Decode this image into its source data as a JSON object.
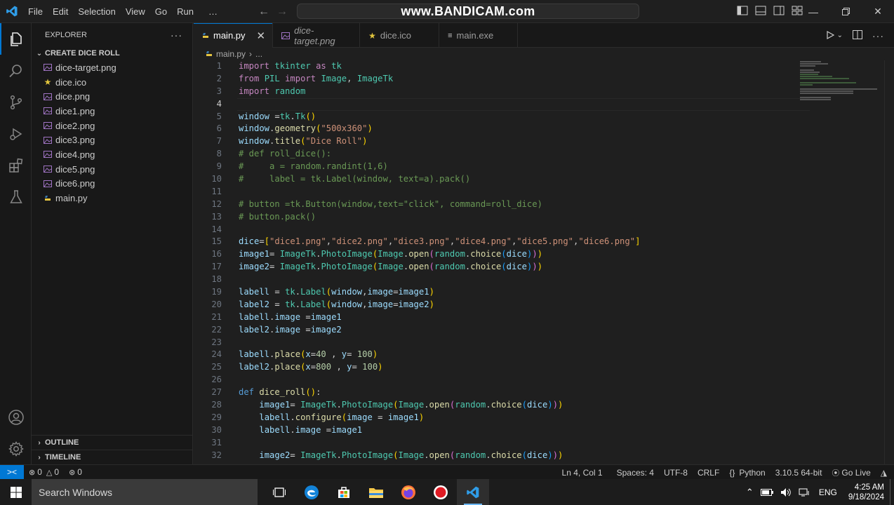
{
  "menu": [
    "File",
    "Edit",
    "Selection",
    "View",
    "Go",
    "Run",
    "…"
  ],
  "watermark": "www.BANDICAM.com",
  "sidebar": {
    "title": "EXPLORER",
    "more": "···",
    "folder": "CREATE DICE ROLL",
    "files": [
      {
        "name": "dice-target.png",
        "icon": "image-file-icon"
      },
      {
        "name": "dice.ico",
        "icon": "star-file-icon"
      },
      {
        "name": "dice.png",
        "icon": "image-file-icon"
      },
      {
        "name": "dice1.png",
        "icon": "image-file-icon"
      },
      {
        "name": "dice2.png",
        "icon": "image-file-icon"
      },
      {
        "name": "dice3.png",
        "icon": "image-file-icon"
      },
      {
        "name": "dice4.png",
        "icon": "image-file-icon"
      },
      {
        "name": "dice5.png",
        "icon": "image-file-icon"
      },
      {
        "name": "dice6.png",
        "icon": "image-file-icon"
      },
      {
        "name": "main.py",
        "icon": "python-file-icon"
      }
    ],
    "outline": "OUTLINE",
    "timeline": "TIMELINE"
  },
  "tabs": [
    {
      "label": "main.py",
      "active": true,
      "close": "✕"
    },
    {
      "label": "dice-target.png",
      "italic": true
    },
    {
      "label": "dice.ico"
    },
    {
      "label": "main.exe"
    }
  ],
  "breadcrumb": {
    "file": "main.py",
    "sep": "›",
    "more": "..."
  },
  "editor": {
    "cursor_line": 4,
    "lines": [
      "1",
      "2",
      "3",
      "4",
      "5",
      "6",
      "7",
      "8",
      "9",
      "10",
      "11",
      "12",
      "13",
      "14",
      "15",
      "16",
      "17",
      "18",
      "19",
      "20",
      "21",
      "22",
      "23",
      "24",
      "25",
      "26",
      "27",
      "28",
      "29",
      "30",
      "31",
      "32"
    ]
  },
  "statusbar": {
    "remote": "><",
    "errors": "0",
    "warnings": "0",
    "ports": "0",
    "position": "Ln 4, Col 1",
    "spaces": "Spaces: 4",
    "encoding": "UTF-8",
    "eol": "CRLF",
    "language": "Python",
    "interpreter": "3.10.5 64-bit",
    "golive": "Go Live"
  },
  "taskbar": {
    "search_placeholder": "Search Windows",
    "lang": "ENG",
    "time": "4:25 AM",
    "date": "9/18/2024"
  }
}
